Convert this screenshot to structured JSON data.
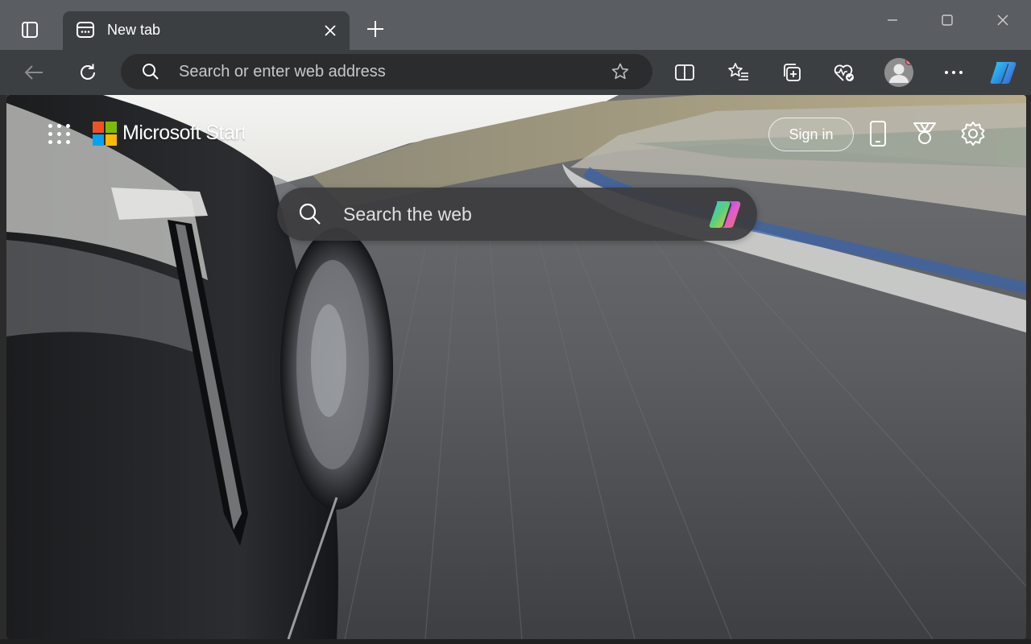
{
  "browser": {
    "tab": {
      "title": "New tab",
      "close_icon": "close-icon",
      "favicon": "new-tab-page-icon"
    },
    "new_tab_icon": "plus-icon",
    "window_controls": [
      "minimize-icon",
      "maximize-icon",
      "close-icon"
    ]
  },
  "toolbar": {
    "back_icon": "back-arrow-icon",
    "refresh_icon": "refresh-icon",
    "address_placeholder": "Search or enter web address",
    "address_value": "",
    "favorite_icon": "star-icon",
    "buttons": [
      "split-screen-icon",
      "favorites-icon",
      "collections-icon",
      "browser-essentials-icon",
      "profile-avatar",
      "more-icon",
      "copilot-icon"
    ]
  },
  "page": {
    "brand": "Microsoft Start",
    "sign_in_label": "Sign in",
    "search_placeholder": "Search the web",
    "header_icons": [
      "phone-icon",
      "rewards-icon",
      "settings-icon"
    ]
  },
  "colors": {
    "titlebar": "#5a5d61",
    "toolbar": "#3c3f42",
    "address_bg": "#2a2c2e",
    "ms_red": "#f25022",
    "ms_green": "#7fba00",
    "ms_blue": "#00a4ef",
    "ms_yellow": "#ffb900"
  }
}
